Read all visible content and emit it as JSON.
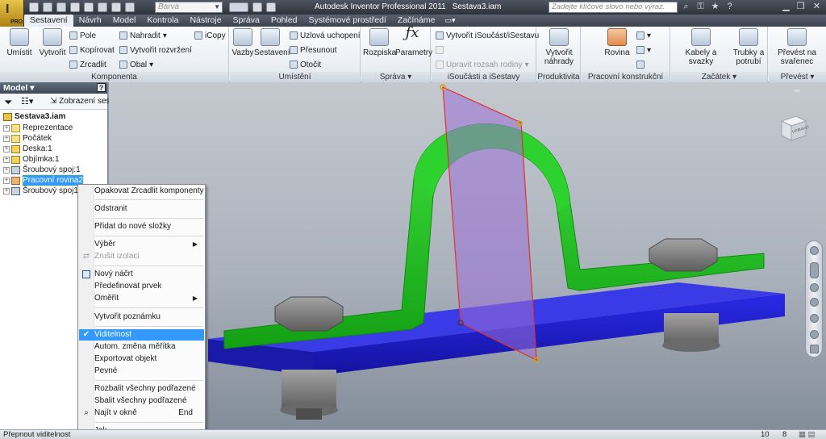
{
  "app": {
    "logo_text": "I",
    "badge": "PRO"
  },
  "window": {
    "product": "Autodesk Inventor Professional 2011",
    "document": "Sestava3.iam"
  },
  "qat": {
    "color_selector": "Barva"
  },
  "search": {
    "placeholder": "Zadejte klíčové slovo nebo výraz."
  },
  "tabs": [
    "Sestavení",
    "Návrh",
    "Model",
    "Kontrola",
    "Nástroje",
    "Správa",
    "Pohled",
    "Systémové prostředí",
    "Začínáme"
  ],
  "active_tab": "Sestavení",
  "ribbon": {
    "komponenta": {
      "title": "Komponenta",
      "umistit": "Umístit",
      "vytvorit": "Vytvořit",
      "pole": "Pole",
      "kopirovat": "Kopírovat",
      "zrcadlit": "Zrcadlit",
      "nahradit": "Nahradit",
      "vytvorit_rozvrzeni": "Vytvořit rozvržení",
      "obal": "Obal",
      "icopy": "iCopy"
    },
    "umisteni": {
      "title": "Umístění",
      "vazby": "Vazby",
      "sestaveni": "Sestavení",
      "uzlova": "Uzlová uchopení",
      "presunout": "Přesunout",
      "otocit": "Otočit"
    },
    "sprava": {
      "title": "Správa",
      "rozpiska": "Rozpiska",
      "parametry": "Parametry"
    },
    "isoucasti": {
      "title": "iSoučásti a iSestavy",
      "vytvorit": "Vytvořit iSoučást/iSestavu",
      "upravit": "Upravit rozsah rodiny"
    },
    "produktivita": {
      "title": "Produktivita",
      "vytvorit_nahrady": "Vytvořit náhrady"
    },
    "pracovni": {
      "title": "Pracovní konstrukční prvky",
      "rovina": "Rovina"
    },
    "zacatek": {
      "title": "Začátek",
      "kabely": "Kabely a svazky",
      "trubky": "Trubky a potrubí"
    },
    "prevest": {
      "title": "Převést",
      "prevest_na_svarenec": "Převést na svařenec"
    }
  },
  "browser": {
    "title": "Model",
    "help": "?",
    "toolbar_label": "Zobrazení ses",
    "root": "Sestava3.iam",
    "nodes": [
      {
        "label": "Reprezentace",
        "icon": "folder"
      },
      {
        "label": "Počátek",
        "icon": "folder"
      },
      {
        "label": "Deska:1",
        "icon": "part"
      },
      {
        "label": "Objímka:1",
        "icon": "part"
      },
      {
        "label": "Šroubový spoj:1",
        "icon": "bolt"
      },
      {
        "label": "Pracovní rovina2",
        "icon": "plane"
      },
      {
        "label": "Šroubový spoj1_",
        "icon": "bolt"
      }
    ]
  },
  "context_menu": {
    "items": [
      {
        "label": "Opakovat Zrcadlit komponenty",
        "enabled": true
      },
      {
        "label": "Odstranit",
        "enabled": true
      },
      {
        "label": "Přidat do nové složky",
        "enabled": true
      },
      {
        "label": "Výběr",
        "enabled": true,
        "submenu": true
      },
      {
        "label": "Zrušit izolaci",
        "enabled": false
      },
      {
        "label": "Nový náčrt",
        "enabled": true
      },
      {
        "label": "Předefinovat prvek",
        "enabled": true
      },
      {
        "label": "Oměřit",
        "enabled": true,
        "submenu": true
      },
      {
        "label": "Vytvořit poznámku",
        "enabled": true
      },
      {
        "label": "Viditelnost",
        "enabled": true,
        "checked": true
      },
      {
        "label": "Autom. změna měřítka",
        "enabled": true
      },
      {
        "label": "Exportovat objekt",
        "enabled": true
      },
      {
        "label": "Pevné",
        "enabled": true
      },
      {
        "label": "Rozbalit všechny podřazené",
        "enabled": true
      },
      {
        "label": "Sbalit všechny podřazené",
        "enabled": true
      },
      {
        "label": "Najít v okně",
        "enabled": true,
        "shortcut": "End"
      },
      {
        "label": "Jak...",
        "enabled": true
      }
    ],
    "highlighted": "Viditelnost"
  },
  "status": {
    "text": "Přepnout viditelnost",
    "n1": "10",
    "n2": "8"
  },
  "viewcube_label": "VPRAVO",
  "colors": {
    "clamp": "#1fc41f",
    "base": "#1a1ad6",
    "plane": "#9b6fd6",
    "bolt": "#7e7e7e",
    "selection": "#3399ff"
  }
}
